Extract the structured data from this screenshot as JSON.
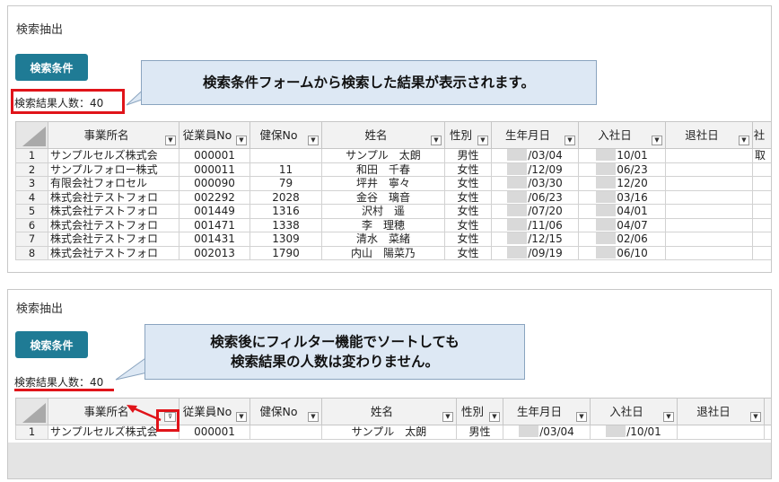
{
  "panel1": {
    "title": "検索抽出",
    "button": "検索条件",
    "count_label": "検索結果人数：40",
    "callout": "検索条件フォームから検索した結果が表示されます。"
  },
  "panel2": {
    "title": "検索抽出",
    "button": "検索条件",
    "count_label": "検索結果人数：40",
    "callout_line1": "検索後にフィルター機能でソートしても",
    "callout_line2": "検索結果の人数は変わりません。"
  },
  "columns": [
    "事業所名",
    "従業員No",
    "健保No",
    "姓名",
    "性別",
    "生年月日",
    "入社日",
    "退社日",
    "社"
  ],
  "rows": [
    {
      "n": "1",
      "office": "サンプルセルズ株式会",
      "emp": "000001",
      "hoken": "",
      "name": "サンプル　太朗",
      "sex": "男性",
      "birth": "/03/04",
      "join": "10/01",
      "leave": "",
      "extra": "取"
    },
    {
      "n": "2",
      "office": "サンプルフォロー株式",
      "emp": "000011",
      "hoken": "11",
      "name": "和田　千春",
      "sex": "女性",
      "birth": "/12/09",
      "join": "06/23",
      "leave": "",
      "extra": ""
    },
    {
      "n": "3",
      "office": "有限会社フォロセル",
      "emp": "000090",
      "hoken": "79",
      "name": "坪井　寧々",
      "sex": "女性",
      "birth": "/03/30",
      "join": "12/20",
      "leave": "",
      "extra": ""
    },
    {
      "n": "4",
      "office": "株式会社テストフォロ",
      "emp": "002292",
      "hoken": "2028",
      "name": "金谷　璃音",
      "sex": "女性",
      "birth": "/06/23",
      "join": "03/16",
      "leave": "",
      "extra": ""
    },
    {
      "n": "5",
      "office": "株式会社テストフォロ",
      "emp": "001449",
      "hoken": "1316",
      "name": "沢村　遥",
      "sex": "女性",
      "birth": "/07/20",
      "join": "04/01",
      "leave": "",
      "extra": ""
    },
    {
      "n": "6",
      "office": "株式会社テストフォロ",
      "emp": "001471",
      "hoken": "1338",
      "name": "李　理穂",
      "sex": "女性",
      "birth": "/11/06",
      "join": "04/07",
      "leave": "",
      "extra": ""
    },
    {
      "n": "7",
      "office": "株式会社テストフォロ",
      "emp": "001431",
      "hoken": "1309",
      "name": "清水　菜緒",
      "sex": "女性",
      "birth": "/12/15",
      "join": "02/06",
      "leave": "",
      "extra": ""
    },
    {
      "n": "8",
      "office": "株式会社テストフォロ",
      "emp": "002013",
      "hoken": "1790",
      "name": "内山　陽菜乃",
      "sex": "女性",
      "birth": "/09/19",
      "join": "06/10",
      "leave": "",
      "extra": ""
    }
  ],
  "filtered_row": {
    "n": "1",
    "office": "サンプルセルズ株式会",
    "emp": "000001",
    "hoken": "",
    "name": "サンプル　太朗",
    "sex": "男性",
    "birth": "/03/04",
    "join": "/10/01",
    "leave": ""
  },
  "icons": {
    "dropdown": "dropdown-arrow-icon",
    "filter": "filter-icon"
  },
  "colors": {
    "button": "#1f7b95",
    "highlight": "#e0141a",
    "callout": "#dde8f4"
  }
}
